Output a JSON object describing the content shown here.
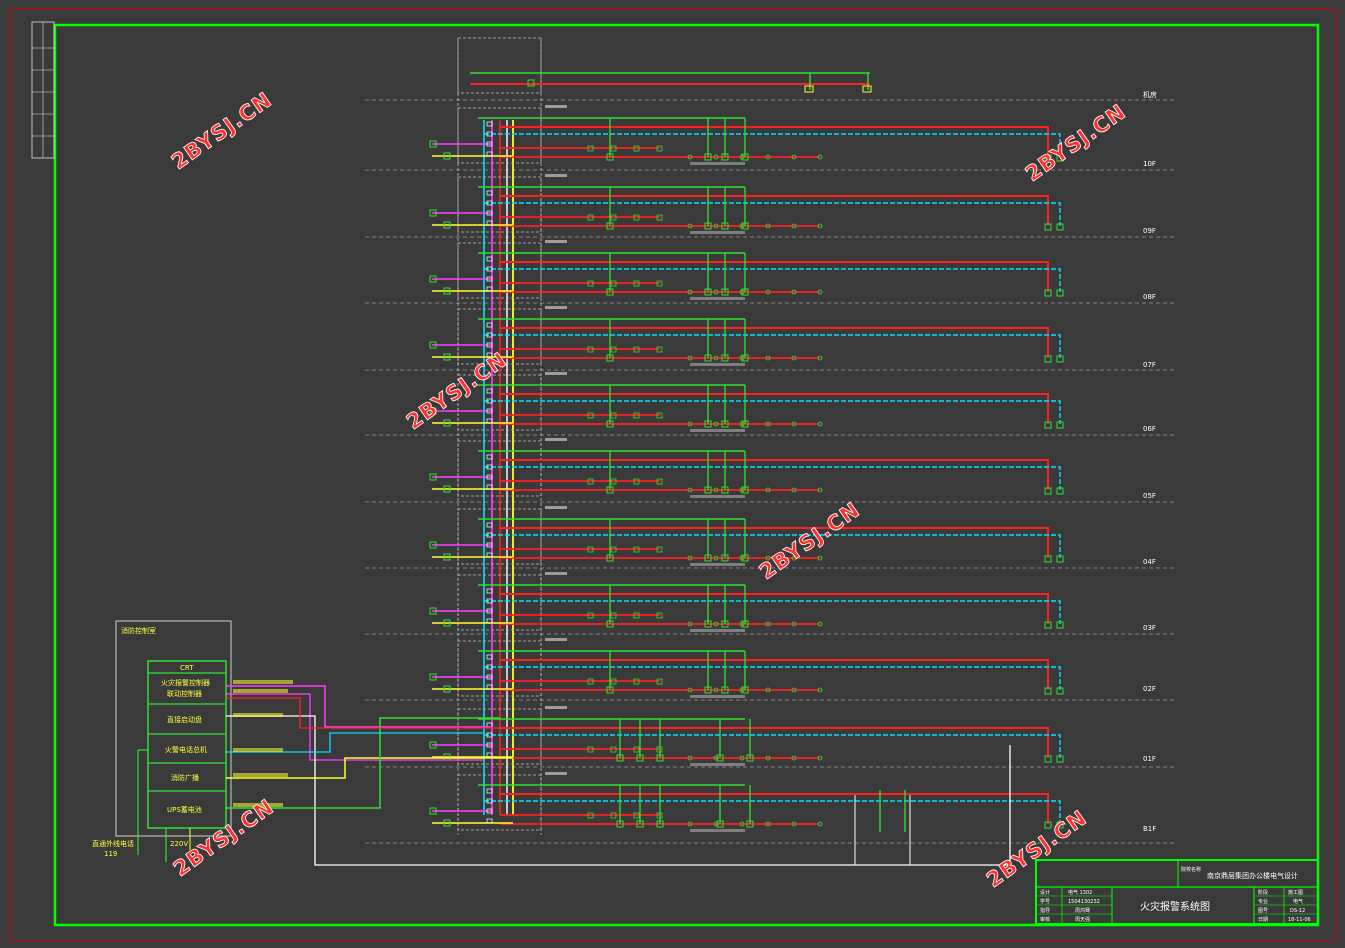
{
  "floors": [
    {
      "label": "机房"
    },
    {
      "label": "10F"
    },
    {
      "label": "09F"
    },
    {
      "label": "08F"
    },
    {
      "label": "07F"
    },
    {
      "label": "06F"
    },
    {
      "label": "05F"
    },
    {
      "label": "04F"
    },
    {
      "label": "03F"
    },
    {
      "label": "02F"
    },
    {
      "label": "01F"
    },
    {
      "label": "B1F"
    }
  ],
  "control_room": {
    "title": "消防控制室",
    "units": [
      {
        "label": "CRT"
      },
      {
        "label": "火灾报警控制器"
      },
      {
        "label": "联动控制器"
      },
      {
        "label": "直接启动盘"
      },
      {
        "label": "火警电话总机"
      },
      {
        "label": "消防广播"
      },
      {
        "label": "UPS蓄电池"
      }
    ],
    "bottom_left_label_1": "直通外线电话",
    "bottom_left_label_2": "119",
    "bottom_mid_label": "220V"
  },
  "title_block": {
    "school": "院校名称",
    "project": "南京鼎层集团办公楼电气设计",
    "drawing_title": "火灾报警系统图",
    "rows_left": [
      "设计",
      "学号",
      "指导",
      "审核"
    ],
    "rows_left_values": [
      "电气 1302",
      "1504130232",
      "周鸿骞",
      "周天强"
    ],
    "rows_right": [
      "阶段",
      "专业",
      "图号",
      "日期"
    ],
    "rows_right_values": [
      "施工图",
      "电气",
      "DS-12",
      "18-11-06"
    ]
  },
  "watermarks": [
    "2BYSJ.CN",
    "2BYSJ.CN",
    "2BYSJ.CN",
    "2BYSJ.CN",
    "2BYSJ.CN",
    "2BYSJ.CN"
  ],
  "colors": {
    "background": "#3a3a3a",
    "frame": "#00ff00",
    "outer_frame": "#c00000",
    "alarm_bus": "#ff2020",
    "signal_bus": "#00e0ff",
    "module_bus": "#30e030",
    "power_bus": "#ffff30",
    "broadcast_bus": "#ff40ff",
    "phone_bus": "#ffffff"
  }
}
